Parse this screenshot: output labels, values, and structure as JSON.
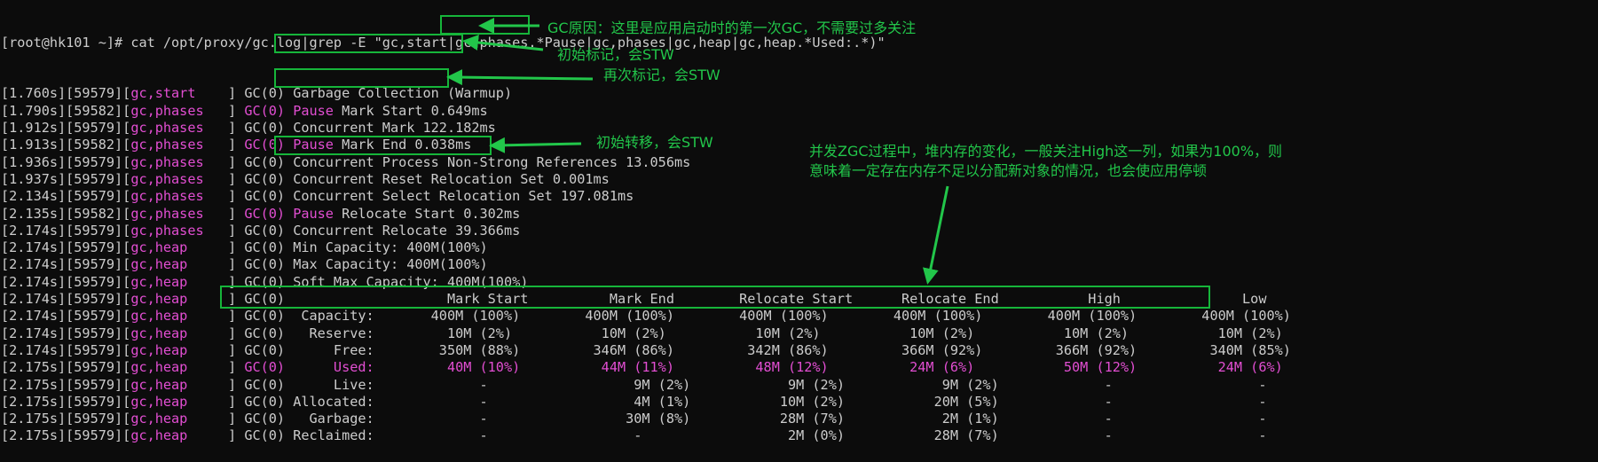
{
  "terminal": {
    "prompt": "[root@hk101 ~]# ",
    "command": "cat /opt/proxy/gc.log|grep -E \"gc,start|gc,phases.*Pause|gc,phases|gc,heap|gc,heap.*Used:.*)\"",
    "lines": [
      {
        "prefix": "[1.760s][59579][",
        "tag": "gc,start    ",
        "sep": "] ",
        "gcid": "GC(0) ",
        "text": "Garbage Collection (Warmup)",
        "pause": ""
      },
      {
        "prefix": "[1.790s][59582][",
        "tag": "gc,phases   ",
        "sep": "] ",
        "gcid": "GC(0) ",
        "pause": "Pause",
        "text": " Mark Start 0.649ms"
      },
      {
        "prefix": "[1.912s][59579][",
        "tag": "gc,phases   ",
        "sep": "] ",
        "gcid": "GC(0) ",
        "pause": "",
        "text": "Concurrent Mark 122.182ms"
      },
      {
        "prefix": "[1.913s][59582][",
        "tag": "gc,phases   ",
        "sep": "] ",
        "gcid": "GC(0) ",
        "pause": "Pause",
        "text": " Mark End 0.038ms"
      },
      {
        "prefix": "[1.936s][59579][",
        "tag": "gc,phases   ",
        "sep": "] ",
        "gcid": "GC(0) ",
        "pause": "",
        "text": "Concurrent Process Non-Strong References 13.056ms"
      },
      {
        "prefix": "[1.937s][59579][",
        "tag": "gc,phases   ",
        "sep": "] ",
        "gcid": "GC(0) ",
        "pause": "",
        "text": "Concurrent Reset Relocation Set 0.001ms"
      },
      {
        "prefix": "[2.134s][59579][",
        "tag": "gc,phases   ",
        "sep": "] ",
        "gcid": "GC(0) ",
        "pause": "",
        "text": "Concurrent Select Relocation Set 197.081ms"
      },
      {
        "prefix": "[2.135s][59582][",
        "tag": "gc,phases   ",
        "sep": "] ",
        "gcid": "GC(0) ",
        "pause": "Pause",
        "text": " Relocate Start 0.302ms"
      },
      {
        "prefix": "[2.174s][59579][",
        "tag": "gc,phases   ",
        "sep": "] ",
        "gcid": "GC(0) ",
        "pause": "",
        "text": "Concurrent Relocate 39.366ms"
      },
      {
        "prefix": "[2.174s][59579][",
        "tag": "gc,heap     ",
        "sep": "] ",
        "gcid": "GC(0) ",
        "pause": "",
        "text": "Min Capacity: 400M(100%)"
      },
      {
        "prefix": "[2.174s][59579][",
        "tag": "gc,heap     ",
        "sep": "] ",
        "gcid": "GC(0) ",
        "pause": "",
        "text": "Max Capacity: 400M(100%)"
      },
      {
        "prefix": "[2.174s][59579][",
        "tag": "gc,heap     ",
        "sep": "] ",
        "gcid": "GC(0) ",
        "pause": "",
        "text": "Soft Max Capacity: 400M(100%)"
      },
      {
        "prefix": "[2.174s][59579][",
        "tag": "gc,heap     ",
        "sep": "] ",
        "gcid": "GC(0) ",
        "pause": "",
        "text": "                   Mark Start          Mark End        Relocate Start      Relocate End           High               Low"
      },
      {
        "prefix": "[2.174s][59579][",
        "tag": "gc,heap     ",
        "sep": "] ",
        "gcid": "GC(0) ",
        "pause": "",
        "text": " Capacity:       400M (100%)        400M (100%)        400M (100%)        400M (100%)        400M (100%)        400M (100%)"
      },
      {
        "prefix": "[2.174s][59579][",
        "tag": "gc,heap     ",
        "sep": "] ",
        "gcid": "GC(0) ",
        "pause": "",
        "text": "  Reserve:         10M (2%)           10M (2%)           10M (2%)           10M (2%)           10M (2%)           10M (2%)"
      },
      {
        "prefix": "[2.174s][59579][",
        "tag": "gc,heap     ",
        "sep": "] ",
        "gcid": "GC(0) ",
        "pause": "",
        "text": "     Free:        350M (88%)         346M (86%)         342M (86%)         366M (92%)         366M (92%)         340M (85%)"
      },
      {
        "prefix": "[2.175s][59579][",
        "tag": "gc,heap     ",
        "sep": "] ",
        "gcid": "GC(0) ",
        "pause": "",
        "text": "     Used:         40M (10%)          44M (11%)          48M (12%)          24M (6%)           50M (12%)          24M (6%)",
        "highlight": true
      },
      {
        "prefix": "[2.175s][59579][",
        "tag": "gc,heap     ",
        "sep": "] ",
        "gcid": "GC(0) ",
        "pause": "",
        "text": "     Live:             -                  9M (2%)            9M (2%)            9M (2%)             -                  -"
      },
      {
        "prefix": "[2.175s][59579][",
        "tag": "gc,heap     ",
        "sep": "] ",
        "gcid": "GC(0) ",
        "pause": "",
        "text": "Allocated:             -                  4M (1%)           10M (2%)           20M (5%)             -                  -"
      },
      {
        "prefix": "[2.175s][59579][",
        "tag": "gc,heap     ",
        "sep": "] ",
        "gcid": "GC(0) ",
        "pause": "",
        "text": "  Garbage:             -                 30M (8%)           28M (7%)            2M (1%)             -                  -"
      },
      {
        "prefix": "[2.175s][59579][",
        "tag": "gc,heap     ",
        "sep": "] ",
        "gcid": "GC(0) ",
        "pause": "",
        "text": "Reclaimed:             -                  -                  2M (0%)           28M (7%)             -                  -"
      }
    ]
  },
  "annotations": {
    "warmup": "GC原因：这里是应用启动时的第一次GC，不需要过多关注",
    "mark_start": "初始标记，会STW",
    "mark_end": "再次标记，会STW",
    "relocate_start": "初始转移，会STW",
    "heap_line1": "并发ZGC过程中，堆内存的变化，一般关注High这一列，如果为100%，则",
    "heap_line2": "意味着一定存在内存不足以分配新对象的情况，也会使应用停顿"
  },
  "colors": {
    "background": "#0c0c0c",
    "text": "#cccccc",
    "highlight": "#e24ed2",
    "annotation": "#22c64a"
  }
}
